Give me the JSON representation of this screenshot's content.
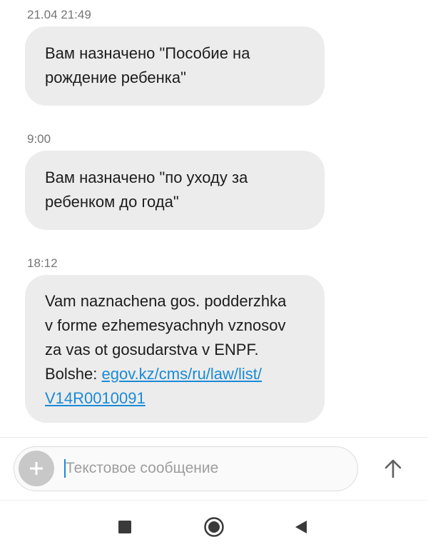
{
  "conversation": {
    "messages": [
      {
        "timestamp": "21.04 21:49",
        "lines": [
          "Вам назначено \"Пособие на",
          "рождение ребенка\""
        ]
      },
      {
        "timestamp": "9:00",
        "lines": [
          "Вам назначено \"по уходу за",
          "ребенком до года\""
        ]
      },
      {
        "timestamp": "18:12",
        "lines": [
          "Vam naznachena gos. podderzhka",
          "v forme ezhemesyachnyh vznosov",
          "za vas ot gosudarstva v ENPF."
        ],
        "link_prefix": "Bolshe: ",
        "link_line1": "egov.kz/cms/ru/law/list/",
        "link_line2": "V14R0010091"
      }
    ]
  },
  "compose": {
    "placeholder": "Текстовое сообщение",
    "attach_icon": "plus-icon",
    "send_icon": "arrow-up-icon"
  },
  "navbar": {
    "recents_icon": "square-icon",
    "home_icon": "circle-icon",
    "back_icon": "triangle-left-icon"
  },
  "colors": {
    "bubble": "#ececec",
    "link": "#1a8ad6",
    "timestamp": "#757575"
  }
}
